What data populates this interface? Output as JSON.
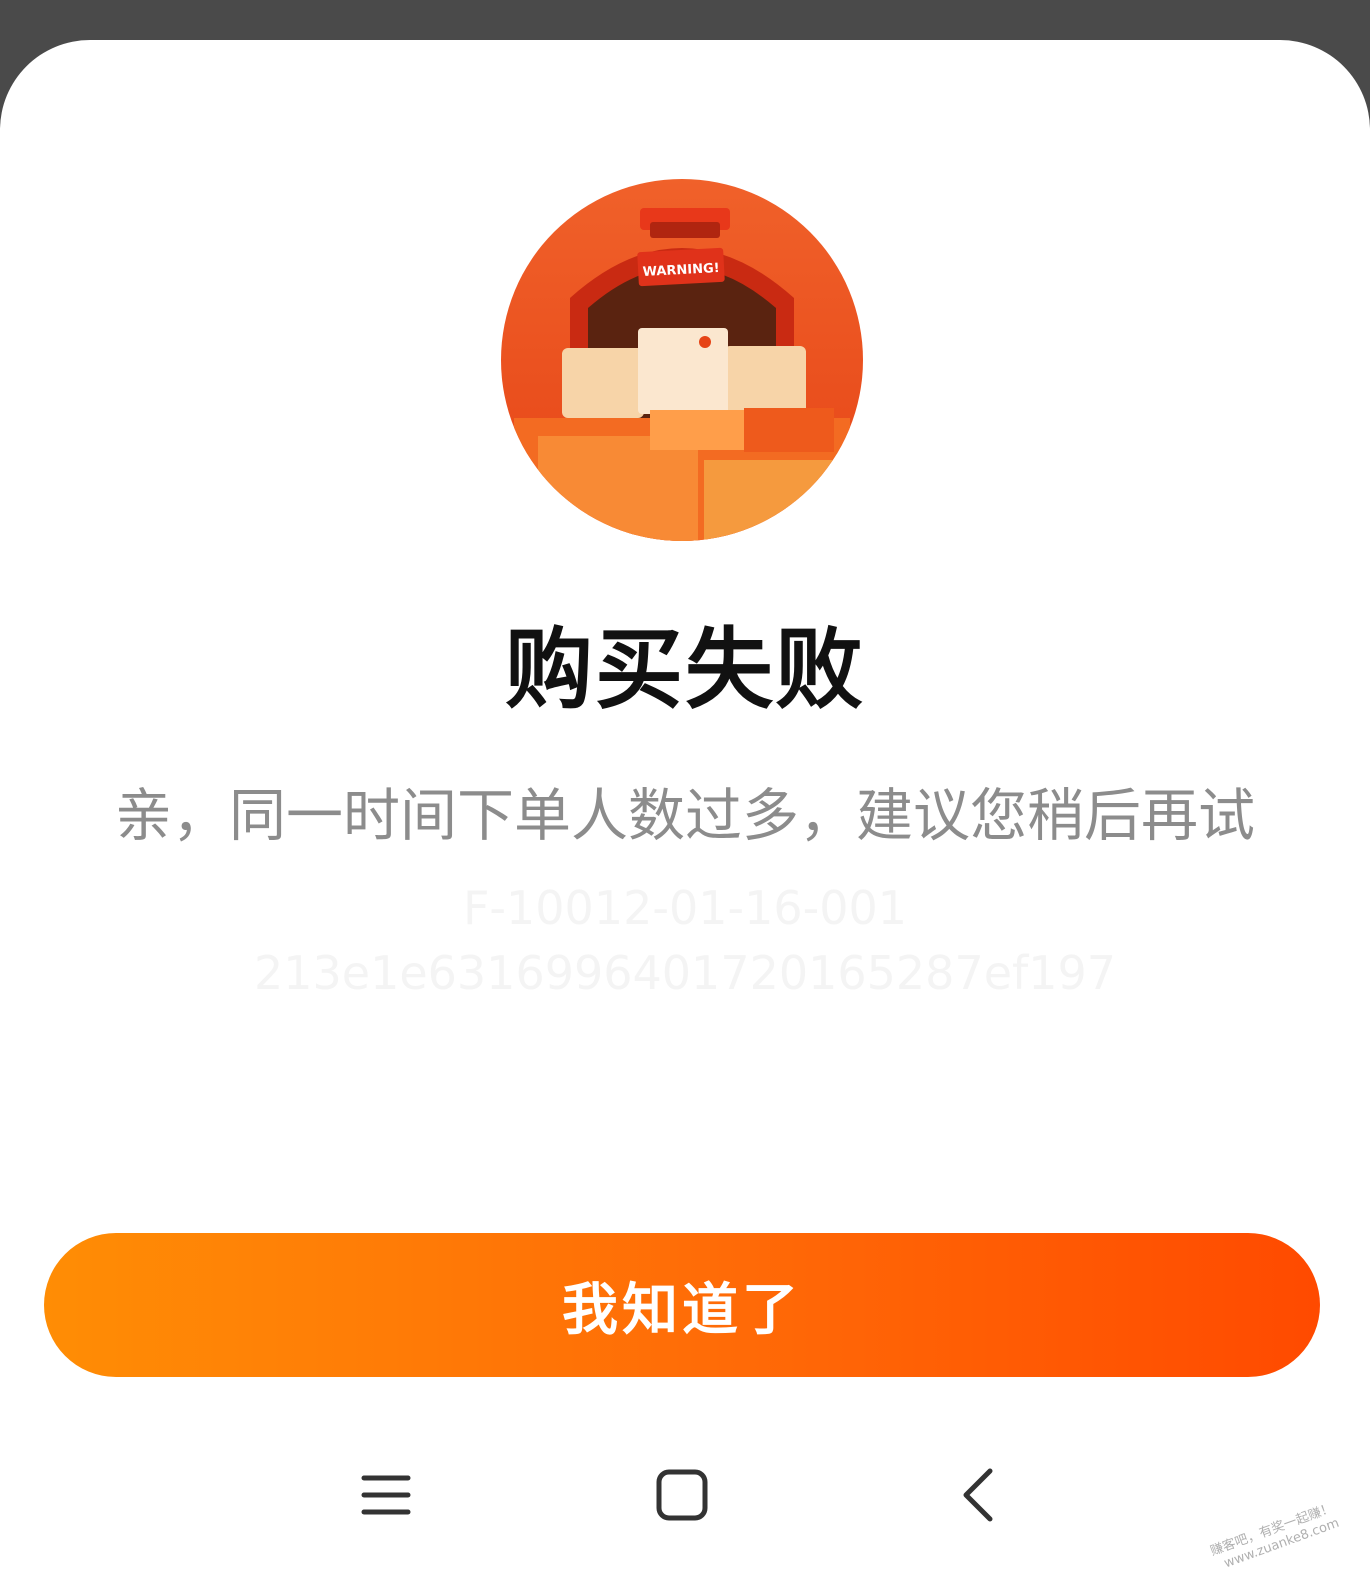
{
  "dialog": {
    "illustration": {
      "name": "warning-delivery-truck-illustration",
      "sign_text": "WARNING!"
    },
    "title": "购买失败",
    "message": "亲，同一时间下单人数过多，建议您稍后再试",
    "error_code_line1": "F-10012-01-16-001",
    "error_code_line2": "213e1e6316996401720165287ef197",
    "confirm_label": "我知道了"
  },
  "nav_bar": {
    "menu_icon": "menu-lines-icon",
    "home_icon": "square-home-icon",
    "back_icon": "chevron-left-icon"
  },
  "watermark": {
    "line1": "赚客吧，有奖一起赚！",
    "line2": "www.zuanke8.com"
  },
  "colors": {
    "accent_start": "#ff8d05",
    "accent_end": "#ff4a00",
    "title": "#111111",
    "message": "#8c8c8c",
    "background_top": "#4a4a4a"
  }
}
